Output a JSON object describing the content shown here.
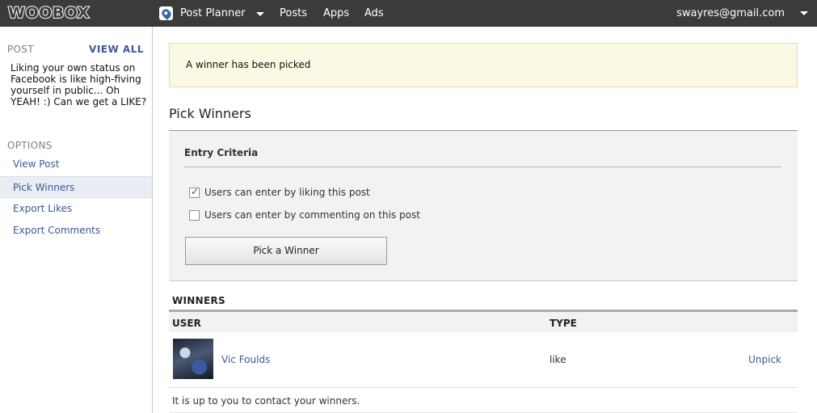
{
  "topbar": {
    "logo": "WOOBOX",
    "app_name": "Post Planner",
    "app_icon": "map-pin-icon",
    "nav": [
      "Posts",
      "Apps",
      "Ads"
    ],
    "account_email": "swayres@gmail.com"
  },
  "sidebar": {
    "post_heading": "POST",
    "view_all": "VIEW ALL",
    "post_text": "Liking your own status on Facebook is like high-fiving yourself in public... Oh YEAH! :) Can we get a LIKE?",
    "options_heading": "OPTIONS",
    "items": [
      {
        "label": "View Post",
        "active": false
      },
      {
        "label": "Pick Winners",
        "active": true
      },
      {
        "label": "Export Likes",
        "active": false
      },
      {
        "label": "Export Comments",
        "active": false
      }
    ]
  },
  "alert": {
    "message": "A winner has been picked"
  },
  "main": {
    "title": "Pick Winners",
    "criteria": {
      "heading": "Entry Criteria",
      "options": [
        {
          "label": "Users can enter by liking this post",
          "checked": true
        },
        {
          "label": "Users can enter by commenting on this post",
          "checked": false
        }
      ],
      "button_label": "Pick a Winner"
    },
    "winners": {
      "heading": "WINNERS",
      "columns": [
        "USER",
        "TYPE"
      ],
      "rows": [
        {
          "user": "Vic Foulds",
          "type": "like",
          "action": "Unpick"
        }
      ],
      "note": "It is up to you to contact your winners."
    }
  },
  "colors": {
    "topbar_bg": "#3b3b3b",
    "link": "#3b5998",
    "alert_bg": "#fbf8e3",
    "panel_bg": "#f2f2f2",
    "active_item_bg": "#e9edf4"
  }
}
